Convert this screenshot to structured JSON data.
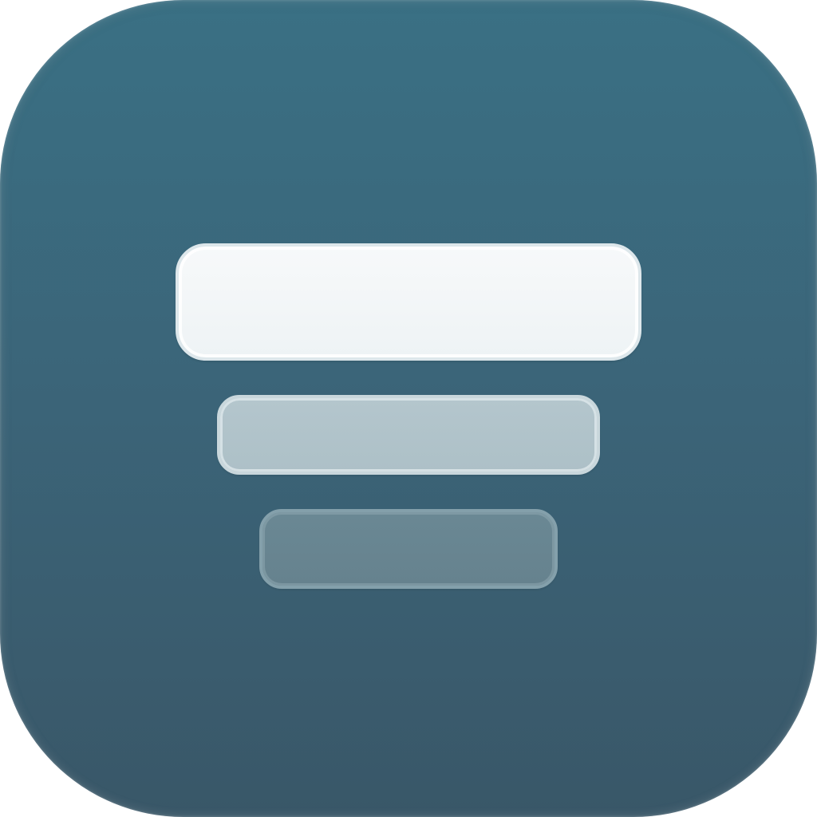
{
  "icon": {
    "name": "three-bar-filter-icon",
    "colors": {
      "background_top": "#3a7084",
      "background_bottom": "#395768",
      "bar_top": "#f2f6f8",
      "bar_middle": "#b0c3ca",
      "bar_bottom": "#68858f"
    }
  }
}
